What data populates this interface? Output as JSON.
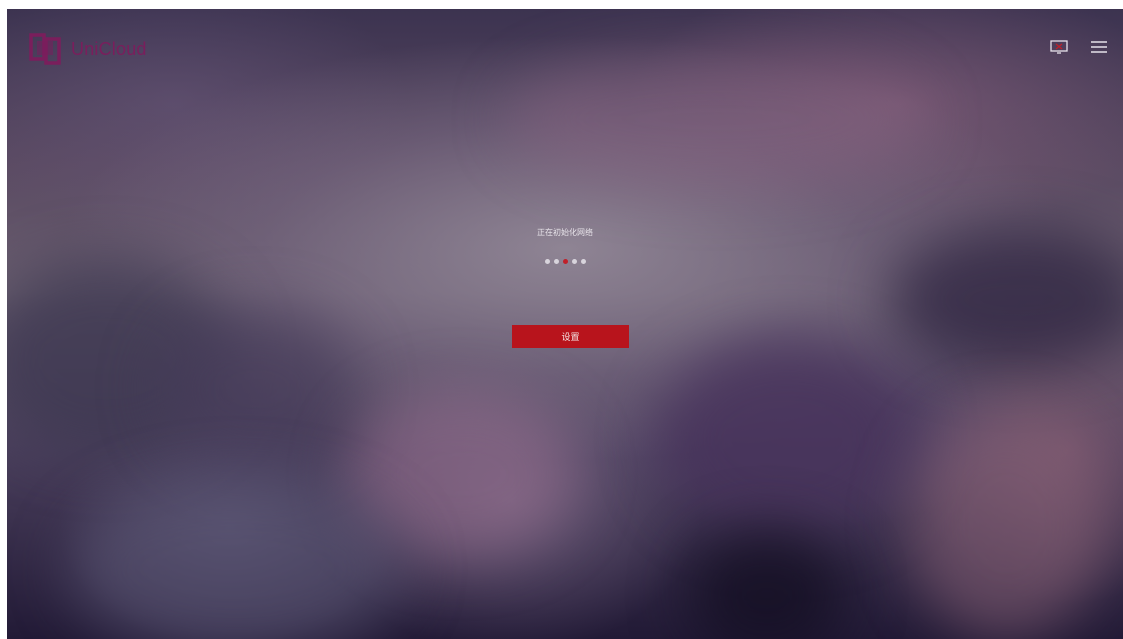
{
  "app": {
    "logo_text": "UniCloud",
    "brand_color": "#7a1e5c"
  },
  "header": {
    "display_icon": "monitor-icon",
    "menu_icon": "hamburger-menu-icon"
  },
  "main": {
    "status_text": "正在初始化网络",
    "progress_dots": {
      "count": 5,
      "active_index": 2,
      "active_color": "#c0202a",
      "inactive_color": "#d8d4dc"
    },
    "settings_button_label": "设置",
    "button_color": "#b8141c"
  }
}
